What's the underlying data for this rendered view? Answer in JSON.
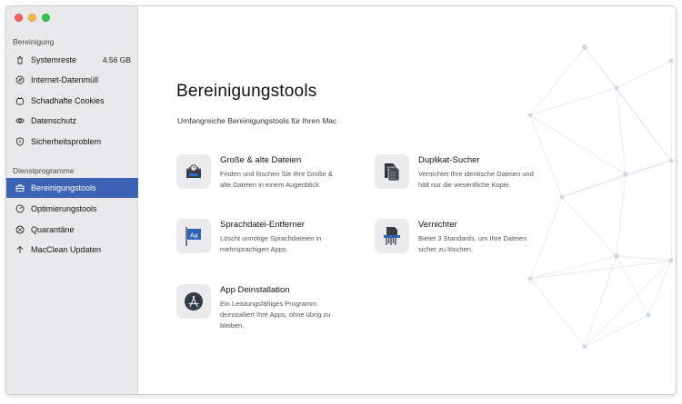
{
  "sidebar": {
    "sections": [
      {
        "title": "Bereinigung",
        "items": [
          {
            "label": "Systemreste",
            "size": "4.56 GB",
            "icon": "trash-icon"
          },
          {
            "label": "Internet-Datenmüll",
            "icon": "compass-icon"
          },
          {
            "label": "Schadhafte Cookies",
            "icon": "cookie-icon"
          },
          {
            "label": "Datenschutz",
            "icon": "eye-icon"
          },
          {
            "label": "Sicherheitsproblem",
            "icon": "shield-icon"
          }
        ]
      },
      {
        "title": "Dienstprogramme",
        "items": [
          {
            "label": "Bereinigungstools",
            "icon": "toolbox-icon",
            "active": true
          },
          {
            "label": "Optimierungstools",
            "icon": "gauge-icon"
          },
          {
            "label": "Quarantäne",
            "icon": "quarantine-icon"
          },
          {
            "label": "MacClean Updaten",
            "icon": "upload-arrow-icon"
          }
        ]
      }
    ]
  },
  "main": {
    "title": "Bereinigungstools",
    "subtitle": "Umfangreiche Bereinigungstools für Ihren Mac",
    "tools": [
      {
        "name": "Große & alte Dateien",
        "description": "Finden und löschen Sie Ihre Große & alte Dateien in einem Augenblick.",
        "icon": "large-files-icon"
      },
      {
        "name": "Duplikat-Sucher",
        "description": "Vernichtet Ihre identische Dateien und hält nur die wesentliche Kopie.",
        "icon": "duplicate-files-icon"
      },
      {
        "name": "Sprachdatei-Entferner",
        "description": "Löscht unnötige Sprachdateien in mehrsprachigen Apps.",
        "icon": "language-flag-icon"
      },
      {
        "name": "Vernichter",
        "description": "Bietet 3 Standards, um Ihre Dateien sicher zu löschen.",
        "icon": "shredder-icon"
      },
      {
        "name": "App Deinstallation",
        "description": "Ein Leistungsfähiges Programm deinstalliert Ihre Apps, ohne übrig zu bleiben.",
        "icon": "app-store-icon"
      }
    ]
  },
  "colors": {
    "accent": "#3d63b5",
    "sidebar_bg": "#e9e9ec"
  }
}
